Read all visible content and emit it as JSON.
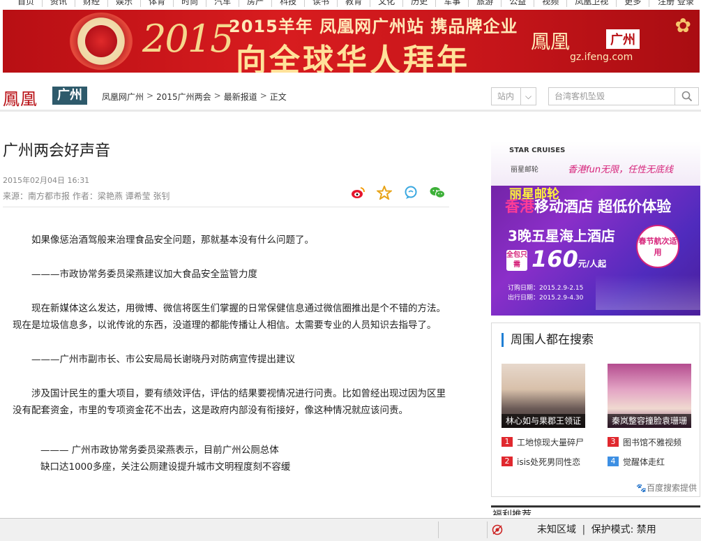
{
  "topnav": {
    "items": [
      "首页",
      "资讯",
      "财经",
      "娱乐",
      "体育",
      "时尚",
      "汽车",
      "房产",
      "科技",
      "读书",
      "教育",
      "文化",
      "历史",
      "军事",
      "旅游",
      "公益",
      "视频",
      "凤凰卫视",
      "更多"
    ],
    "login": "注册 登录"
  },
  "banner": {
    "year_art": "2015",
    "line1": "2015羊年 凤凰网广州站 携品牌企业",
    "line2": "向全球华人拜年",
    "logo": "鳳凰",
    "city": "广州",
    "url": "gz.ifeng.com"
  },
  "header": {
    "logo": "鳳凰",
    "city": "广州",
    "breadcrumb": [
      "凤凰网广州",
      "2015广州两会",
      "最新报道",
      "正文"
    ],
    "scope": "站内",
    "search_placeholder": "台湾客机坠毁"
  },
  "article": {
    "title": "广州两会好声音",
    "date": "2015年02月04日 16:31",
    "source": "来源：南方都市报 作者：梁艳燕 谭希莹 张钊",
    "paragraphs": [
      "如果像惩治酒驾般来治理食品安全问题，那就基本没有什么问题了。",
      "———市政协常务委员梁燕建议加大食品安全监管力度",
      "现在新媒体这么发达，用微博、微信将医生们掌握的日常保健信息通过微信圈推出是个不错的方法。现在是垃圾信息多，以讹传讹的东西，没道理的都能传播让人相信。太需要专业的人员知识去指导了。",
      "———广州市副市长、市公安局局长谢晓丹对防病宣传提出建议",
      "涉及国计民生的重大项目，要有绩效评估，评估的结果要视情况进行问责。比如曾经出现过因为区里没有配套资金，市里的专项资金花不出去，这是政府内部没有衔接好，像这种情况就应该问责。",
      "——— 广州市政协常务委员梁燕表示，目前广州公厕总体\n缺口达1000多座，关注公厕建设提升城市文明程度刻不容缓"
    ]
  },
  "ad": {
    "brand_en": "STAR CRUISES",
    "brand_cn": "丽星邮轮",
    "tagline": "香港fun无限，任性无底线",
    "title1": "丽星邮轮",
    "title2_hk": "香港",
    "title2_rest": "移动酒店 超低价体验",
    "title3": "3晚五星海上酒店",
    "badge": "全包只需",
    "price": "160",
    "price_unit": "元/人起",
    "circle": "春节航次适用",
    "order_date": "订购日期：2015.2.9-2.15",
    "sail_date": "出行日期：2015.2.9-4.30"
  },
  "hot": {
    "title": "周围人都在搜索",
    "pics": [
      {
        "caption": "林心如与果郡王领证"
      },
      {
        "caption": "秦岚整容撞脸袁珊珊"
      }
    ],
    "items_left": [
      {
        "num": "1",
        "text": "工地惊现大量碎尸"
      },
      {
        "num": "2",
        "text": "isis处死男同性恋"
      }
    ],
    "items_right": [
      {
        "num": "3",
        "text": "图书馆不雅视频"
      },
      {
        "num": "4",
        "text": "觉醒体走红"
      }
    ],
    "provider": "百度搜索提供"
  },
  "next_panel": {
    "title": "福利推荐"
  },
  "statusbar": {
    "zone": "未知区域",
    "separator": "|",
    "mode": "保护模式: 禁用"
  },
  "colors": {
    "brand_red": "#b80f14",
    "hot_accent": "#1f7fd4",
    "rank_red": "#e0282e",
    "rank_blue": "#3d8fe3"
  }
}
